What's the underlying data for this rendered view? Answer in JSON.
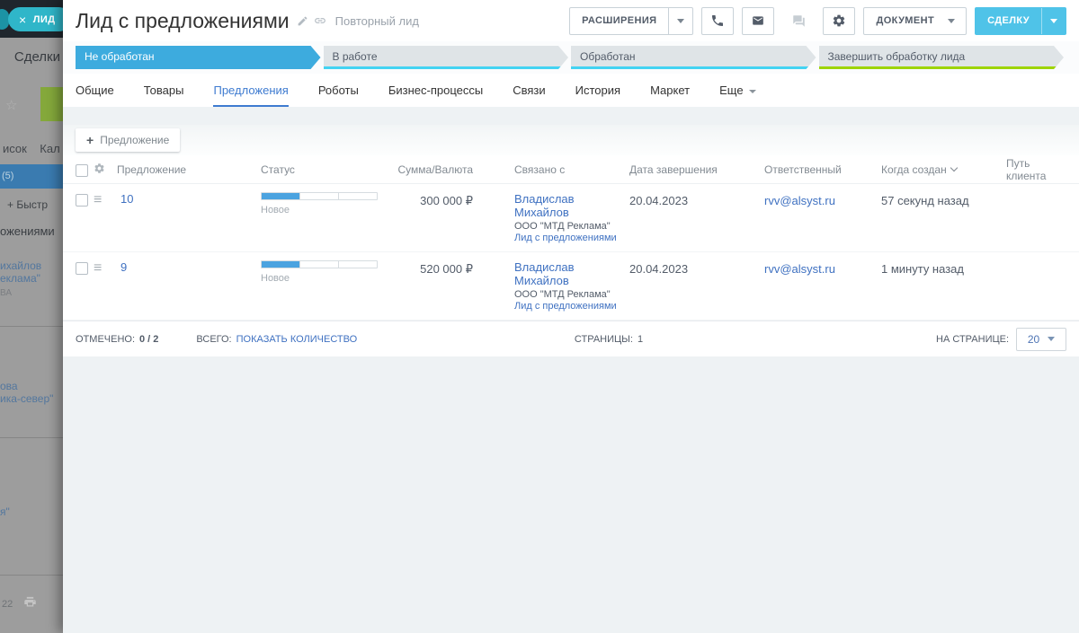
{
  "colors": {
    "stage_active": "#3dabde",
    "stage_inactive": "#dfe4e7",
    "underline_cyan": "#43d3f2",
    "underline_green": "#9ed400",
    "deal_button": "#4fc3e8",
    "lead_pill": "#2fb6c9",
    "link_blue": "#3f71c1",
    "progress_fill": "#4ba3e0"
  },
  "backdrop": {
    "lead_tab_label": "ЛИД",
    "close_glyph": "×",
    "deals_title": "Сделки",
    "star_glyph": "☆",
    "view_tabs_fragment": "исок    Кал",
    "count_fragment": "(5)",
    "quick_add_fragment": "+ Быстр",
    "column_title_fragment": "ожениями",
    "card1_line1": "ихайлов",
    "card1_line2": "еклама\"",
    "card1_line3": "ВА",
    "card2_line1": "ова",
    "card2_line2": "ика-север\"",
    "card3_line1": "я\"",
    "footer_number": "22"
  },
  "header": {
    "title": "Лид с предложениями",
    "subtitle": "Повторный лид",
    "extensions_label": "РАСШИРЕНИЯ",
    "document_label": "ДОКУМЕНТ",
    "deal_label": "СДЕЛКУ"
  },
  "pipeline": {
    "stages": [
      {
        "label": "Не обработан"
      },
      {
        "label": "В работе"
      },
      {
        "label": "Обработан"
      },
      {
        "label": "Завершить обработку лида"
      }
    ]
  },
  "tabs": {
    "items": [
      "Общие",
      "Товары",
      "Предложения",
      "Роботы",
      "Бизнес-процессы",
      "Связи",
      "История",
      "Маркет",
      "Еще"
    ],
    "active": "Предложения"
  },
  "toolbar": {
    "plus_glyph": "+",
    "add_label": "Предложение"
  },
  "table": {
    "menu_glyph": "≡",
    "headers": {
      "offer": "Предложение",
      "status": "Статус",
      "sum": "Сумма/Валюта",
      "related": "Связано с",
      "finish_date": "Дата завершения",
      "responsible": "Ответственный",
      "created": "Когда создан",
      "client_path": "Путь клиента"
    },
    "rows": [
      {
        "id": "10",
        "status_label": "Новое",
        "sum": "300 000 ₽",
        "contact": "Владислав Михайлов",
        "company": "ООО \"МТД Реклама\"",
        "lead_link": "Лид с предложениями",
        "finish_date": "20.04.2023",
        "responsible": "rvv@alsyst.ru",
        "created": "57 секунд назад"
      },
      {
        "id": "9",
        "status_label": "Новое",
        "sum": "520 000 ₽",
        "contact": "Владислав Михайлов",
        "company": "ООО \"МТД Реклама\"",
        "lead_link": "Лид с предложениями",
        "finish_date": "20.04.2023",
        "responsible": "rvv@alsyst.ru",
        "created": "1 минуту назад"
      }
    ]
  },
  "footer": {
    "checked_label": "ОТМЕЧЕНО:",
    "checked_value": "0 / 2",
    "total_label": "ВСЕГО:",
    "total_link": "ПОКАЗАТЬ КОЛИЧЕСТВО",
    "pages_label": "СТРАНИЦЫ:",
    "pages_value": "1",
    "per_page_label": "НА СТРАНИЦЕ:",
    "per_page_value": "20"
  }
}
